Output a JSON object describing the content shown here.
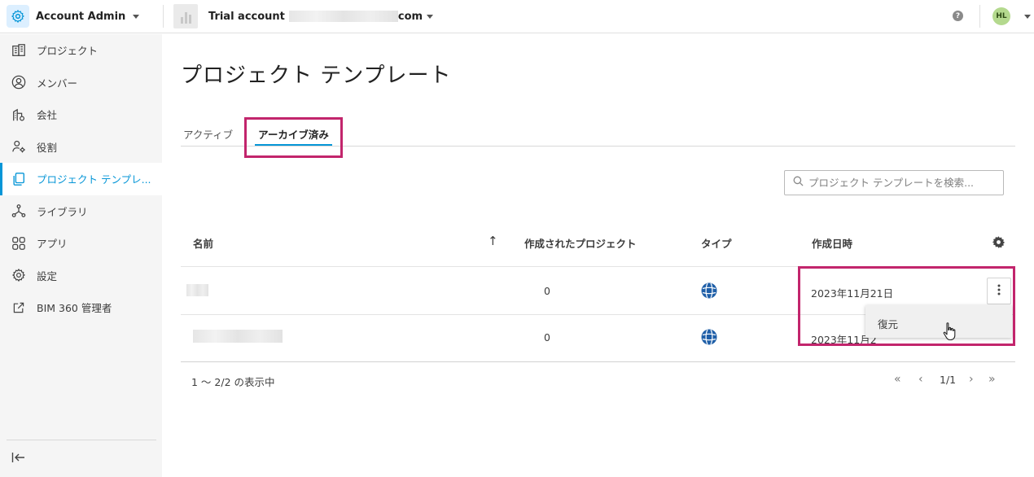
{
  "header": {
    "app_title": "Account Admin",
    "account_prefix": "Trial account",
    "account_suffix": "com",
    "help_label": "?",
    "user_initials": "HL"
  },
  "sidebar": {
    "items": [
      {
        "label": "プロジェクト",
        "icon": "project-icon"
      },
      {
        "label": "メンバー",
        "icon": "member-icon"
      },
      {
        "label": "会社",
        "icon": "company-icon"
      },
      {
        "label": "役割",
        "icon": "role-icon"
      },
      {
        "label": "プロジェクト テンプレ...",
        "icon": "template-icon",
        "active": true
      },
      {
        "label": "ライブラリ",
        "icon": "library-icon"
      },
      {
        "label": "アプリ",
        "icon": "apps-icon"
      },
      {
        "label": "設定",
        "icon": "settings-icon"
      },
      {
        "label": "BIM 360 管理者",
        "icon": "external-link-icon"
      }
    ]
  },
  "main": {
    "title": "プロジェクト テンプレート",
    "tabs": [
      {
        "label": "アクティブ"
      },
      {
        "label": "アーカイブ済み",
        "active": true
      }
    ],
    "search_placeholder": "プロジェクト テンプレートを検索..."
  },
  "table": {
    "columns": [
      "名前",
      "作成されたプロジェクト",
      "タイプ",
      "作成日時"
    ],
    "sort_direction": "↑",
    "rows": [
      {
        "projects": "0",
        "type_icon": "globe-icon",
        "created": "2023年11月21日"
      },
      {
        "projects": "0",
        "type_icon": "globe-icon",
        "created": "2023年11月2"
      }
    ]
  },
  "context_menu": {
    "items": [
      "復元"
    ]
  },
  "footer": {
    "range_text": "1 〜 2/2 の表示中",
    "page_text": "1/1"
  },
  "colors": {
    "accent": "#0696d7",
    "highlight": "#c2256c",
    "globe": "#1f5fa8"
  }
}
